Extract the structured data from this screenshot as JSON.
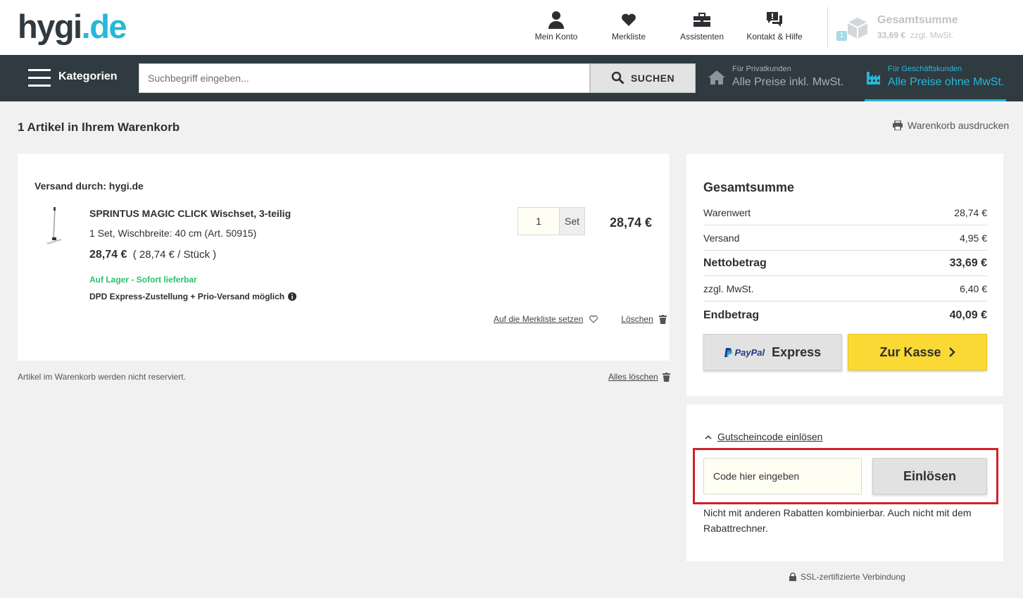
{
  "header": {
    "logo_main": "hygi",
    "logo_dot": ".",
    "logo_tld": "de",
    "nav": [
      {
        "label": "Mein Konto",
        "icon": "user-icon"
      },
      {
        "label": "Merkliste",
        "icon": "heart-icon"
      },
      {
        "label": "Assistenten",
        "icon": "toolbox-icon"
      },
      {
        "label": "Kontakt & Hilfe",
        "icon": "chat-icon"
      }
    ],
    "cart": {
      "title": "Gesamtsumme",
      "amount": "33,69 €",
      "tax_note": "zzgl. MwSt.",
      "count": "1",
      "icon": "box-icon"
    }
  },
  "navbar": {
    "categories_label": "Kategorien",
    "search_placeholder": "Suchbegriff eingeben...",
    "search_button": "SUCHEN",
    "private": {
      "small": "Für Privatkunden",
      "big": "Alle Preise inkl. MwSt.",
      "icon": "home-icon"
    },
    "business": {
      "small": "Für Geschäftskunden",
      "big": "Alle Preise ohne MwSt.",
      "icon": "factory-icon"
    }
  },
  "cart_page": {
    "heading": "1 Artikel in Ihrem Warenkorb",
    "print_label": "Warenkorb ausdrucken",
    "shipping_by": "Versand durch: hygi.de",
    "item": {
      "name": "SPRINTUS MAGIC CLICK Wischset, 3-teilig",
      "detail": "1 Set, Wischbreite: 40 cm (Art. 50915)",
      "price": "28,74 €",
      "unit_price": "( 28,74 € / Stück )",
      "stock": "Auf Lager - Sofort lieferbar",
      "delivery": "DPD Express-Zustellung + Prio-Versand möglich",
      "quantity": "1",
      "unit": "Set",
      "line_total": "28,74 €",
      "wishlist_label": "Auf die Merkliste setzen",
      "delete_label": "Löschen"
    },
    "note": "Artikel im Warenkorb werden nicht reserviert.",
    "clear_all": "Alles löschen"
  },
  "summary": {
    "title": "Gesamtsumme",
    "rows": [
      {
        "label": "Warenwert",
        "value": "28,74 €"
      },
      {
        "label": "Versand",
        "value": "4,95 €"
      },
      {
        "label": "Nettobetrag",
        "value": "33,69 €"
      },
      {
        "label": "zzgl. MwSt.",
        "value": "6,40 €"
      },
      {
        "label": "Endbetrag",
        "value": "40,09 €"
      }
    ],
    "paypal_brand": "PayPal",
    "paypal_label": "Express",
    "checkout_label": "Zur Kasse"
  },
  "coupon": {
    "toggle_label": "Gutscheincode einlösen",
    "placeholder": "Code hier eingeben",
    "button": "Einlösen",
    "note": "Nicht mit anderen Rabatten kombinierbar. Auch nicht mit dem Rabattrechner."
  },
  "footer": {
    "ssl": "SSL-zertifizierte Verbindung"
  },
  "colors": {
    "accent": "#25b8d7",
    "navbar": "#2f3b41",
    "checkout": "#fad934",
    "stock": "#29c16d",
    "highlight": "#d2202b"
  }
}
